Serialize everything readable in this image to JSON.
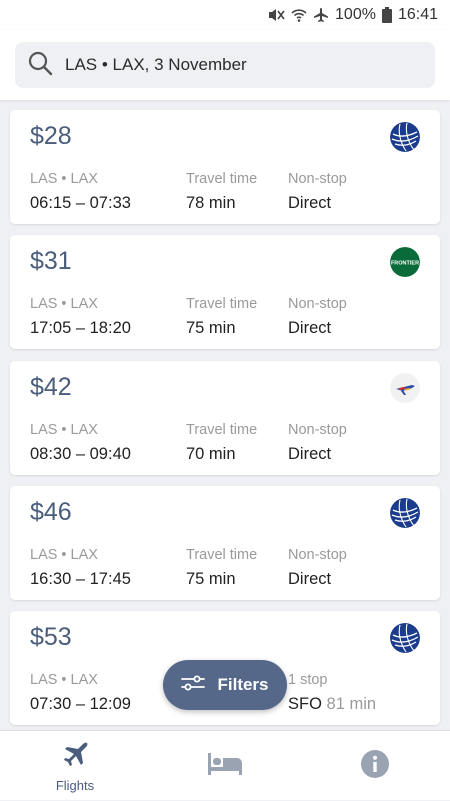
{
  "status_bar": {
    "battery": "100%",
    "time": "16:41"
  },
  "search": {
    "query": "LAS • LAX, 3 November"
  },
  "flights": [
    {
      "price": "$28",
      "airline_logo": "united-globe-logo",
      "route": "LAS • LAX",
      "times": "06:15 – 07:33",
      "travel_label": "Travel time",
      "travel_value": "78 min",
      "stop_label": "Non-stop",
      "stop_value": "Direct",
      "stop_extra": ""
    },
    {
      "price": "$31",
      "airline_logo": "frontier-logo",
      "logo_text": "FRONTIER",
      "route": "LAS • LAX",
      "times": "17:05 – 18:20",
      "travel_label": "Travel time",
      "travel_value": "75 min",
      "stop_label": "Non-stop",
      "stop_value": "Direct",
      "stop_extra": ""
    },
    {
      "price": "$42",
      "airline_logo": "southwest-plane-logo",
      "route": "LAS • LAX",
      "times": "08:30 – 09:40",
      "travel_label": "Travel time",
      "travel_value": "70 min",
      "stop_label": "Non-stop",
      "stop_value": "Direct",
      "stop_extra": ""
    },
    {
      "price": "$46",
      "airline_logo": "united-globe-logo",
      "route": "LAS • LAX",
      "times": "16:30 – 17:45",
      "travel_label": "Travel time",
      "travel_value": "75 min",
      "stop_label": "Non-stop",
      "stop_value": "Direct",
      "stop_extra": ""
    },
    {
      "price": "$53",
      "airline_logo": "united-globe-logo",
      "route": "LAS • LAX",
      "times": "07:30 – 12:09",
      "travel_label": "",
      "travel_value": "",
      "stop_label": "1 stop",
      "stop_value": "SFO",
      "stop_extra": "81 min"
    }
  ],
  "filters_button": {
    "label": "Filters"
  },
  "bottom_nav": {
    "flights_label": "Flights"
  },
  "colors": {
    "accent": "#4a5d7c",
    "filters_bg": "#56688a",
    "background": "#eef0f3"
  }
}
